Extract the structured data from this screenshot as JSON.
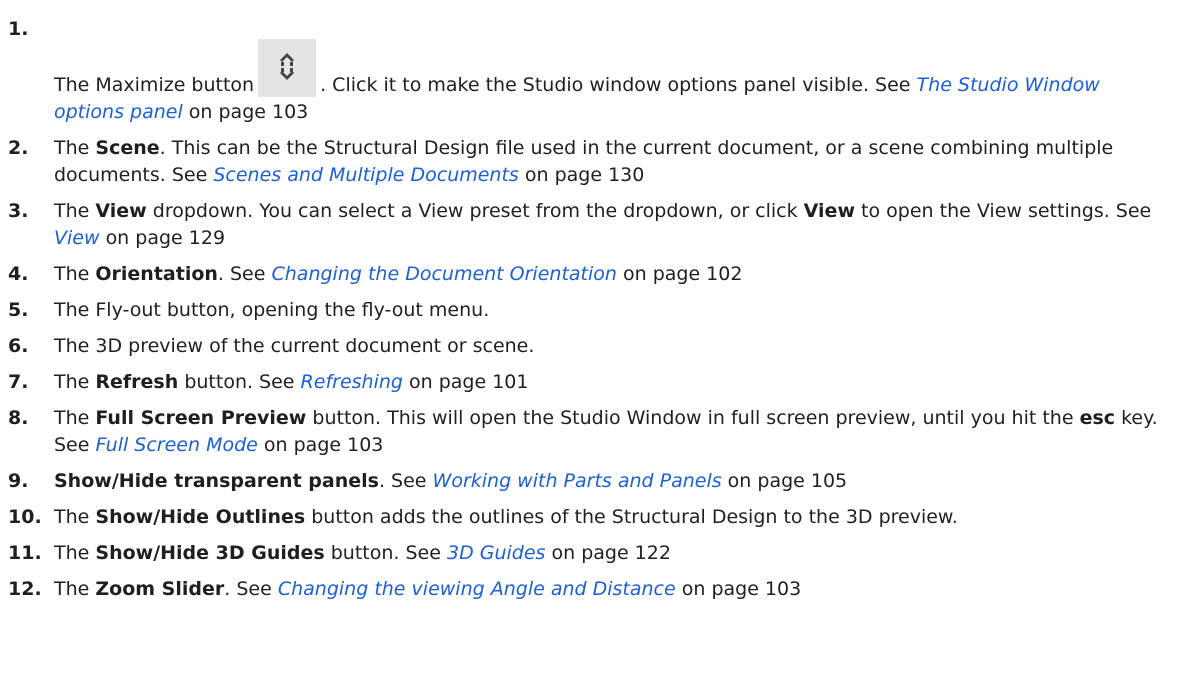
{
  "items": [
    {
      "num": "1.",
      "t1": "The Maximize button",
      "t2": ". Click it to make the Studio window options panel visible. See",
      "link": "The Studio Window options panel",
      "t3": "on page 103",
      "icon": "maximize-button-icon"
    },
    {
      "num": "2.",
      "t1": "The",
      "bold": "Scene",
      "t2": ". This can be the Structural Design file used in the current document, or a scene combining multiple documents. See",
      "link": "Scenes and Multiple Documents",
      "t3": "on page 130"
    },
    {
      "num": "3.",
      "t1": "The",
      "bold": "View",
      "t2": "dropdown. You can select a View preset from the dropdown, or click",
      "bold2": "View",
      "t3": "to open the View settings. See",
      "link": "View",
      "t4": "on page 129"
    },
    {
      "num": "4.",
      "t1": "The",
      "bold": "Orientation",
      "t2": ". See",
      "link": "Changing the Document Orientation",
      "t3": "on page 102"
    },
    {
      "num": "5.",
      "t1": "The Fly-out button, opening the fly-out menu."
    },
    {
      "num": "6.",
      "t1": "The 3D preview of the current document or scene."
    },
    {
      "num": "7.",
      "t1": "The",
      "bold": "Refresh",
      "t2": "button. See",
      "link": "Refreshing",
      "t3": "on page 101"
    },
    {
      "num": "8.",
      "t1": "The",
      "bold": "Full Screen Preview",
      "t2": "button. This will open the Studio Window in full screen preview, until you hit the",
      "bold2": "esc",
      "t3": "key. See",
      "link": "Full Screen Mode",
      "t4": "on page 103"
    },
    {
      "num": "9.",
      "bold": "Show/Hide transparent panels",
      "t1": ". See",
      "link": "Working with Parts and Panels",
      "t2": "on page 105"
    },
    {
      "num": "10.",
      "t1": "The",
      "bold": "Show/Hide Outlines",
      "t2": "button adds the outlines of the Structural Design to the 3D preview."
    },
    {
      "num": "11.",
      "t1": "The",
      "bold": "Show/Hide 3D Guides",
      "t2": "button. See",
      "link": "3D Guides",
      "t3": "on page 122"
    },
    {
      "num": "12.",
      "t1": "The",
      "bold": "Zoom Slider",
      "t2": ". See",
      "link": "Changing the viewing Angle and Distance",
      "t3": "on page 103"
    }
  ]
}
